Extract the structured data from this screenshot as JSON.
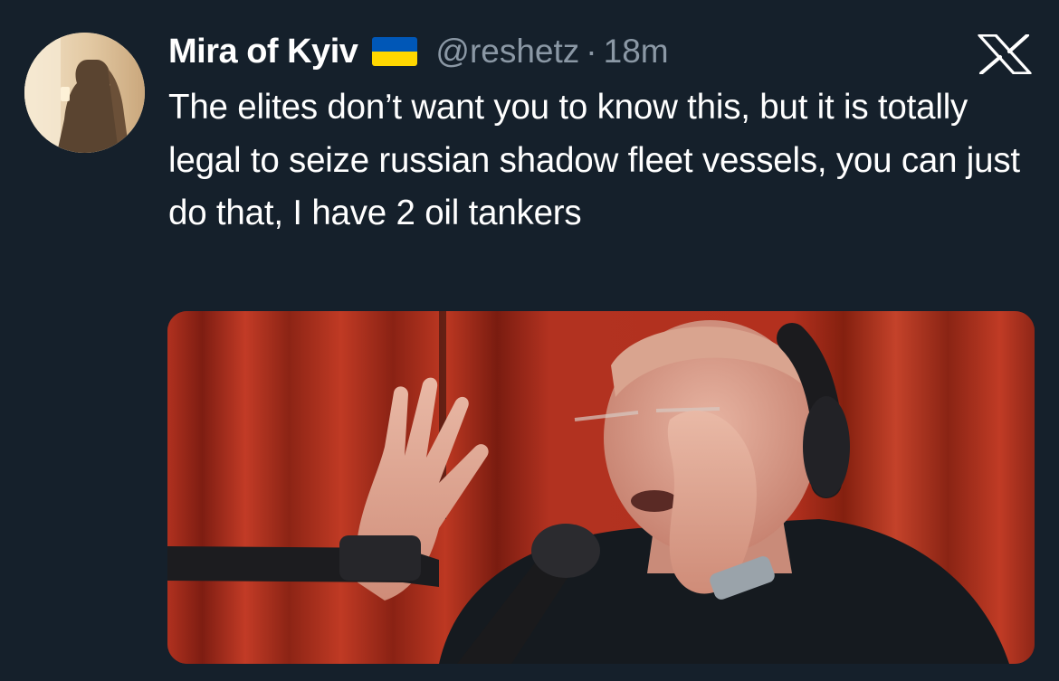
{
  "tweet": {
    "display_name": "Mira of Kyiv",
    "handle": "@reshetz",
    "separator": "·",
    "timestamp": "18m",
    "text": "The elites don’t want you to know this, but it is totally legal to seize russian shadow fleet vessels, you can just do that, I have 2 oil tankers"
  },
  "icons": {
    "flag": "ukraine-flag-icon",
    "brand": "x-logo-icon"
  },
  "colors": {
    "background": "#15202b",
    "text_primary": "#ffffff",
    "text_secondary": "#8b98a5",
    "flag_blue": "#0057b7",
    "flag_yellow": "#ffd700"
  }
}
